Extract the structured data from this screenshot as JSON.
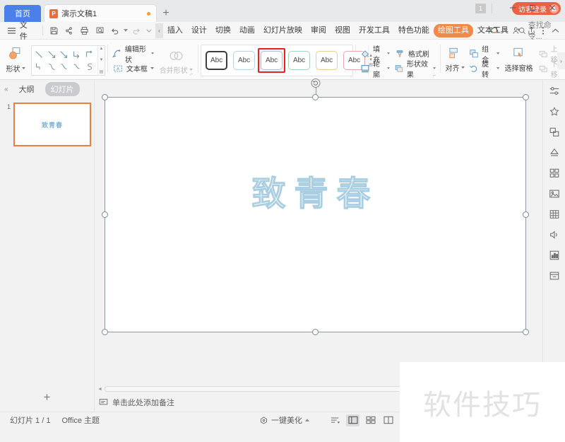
{
  "window": {
    "home_tab": "首页",
    "document_tab": "演示文稿1",
    "new_tab": "+",
    "minimize": "—",
    "maximize": "□",
    "close": "✕",
    "badge_count": "1",
    "login_label": "访客登录"
  },
  "menubar": {
    "file_label": "文件",
    "tabs": [
      {
        "label": "插入",
        "state": "active-underline"
      },
      {
        "label": "设计",
        "state": "normal"
      },
      {
        "label": "切换",
        "state": "normal"
      },
      {
        "label": "动画",
        "state": "normal"
      },
      {
        "label": "幻灯片放映",
        "state": "normal"
      },
      {
        "label": "审阅",
        "state": "normal"
      },
      {
        "label": "视图",
        "state": "normal"
      },
      {
        "label": "开发工具",
        "state": "normal"
      },
      {
        "label": "特色功能",
        "state": "normal"
      },
      {
        "label": "绘图工具",
        "state": "active-orange"
      },
      {
        "label": "文本工具",
        "state": "normal"
      }
    ],
    "search_placeholder": "查找命令..."
  },
  "ribbon": {
    "shapes_label": "形状",
    "edit_shape_label": "编辑形状",
    "textbox_label": "文本框",
    "merge_shapes_label": "合并形状",
    "style_swatches": [
      {
        "label": "Abc",
        "border": "#3d3d3d",
        "selected": false
      },
      {
        "label": "Abc",
        "border": "#b9d3e8",
        "selected": false
      },
      {
        "label": "Abc",
        "border": "#aec4d2",
        "selected": true
      },
      {
        "label": "Abc",
        "border": "#a9d5bd",
        "selected": false
      },
      {
        "label": "Abc",
        "border": "#e8cf92",
        "selected": false
      },
      {
        "label": "Abc",
        "border": "#e8a8a8",
        "selected": false
      }
    ],
    "fill_label": "填充",
    "outline_label": "轮廓",
    "format_painter_label": "格式刷",
    "shape_effects_label": "形状效果",
    "align_label": "对齐",
    "group_label": "组合",
    "rotate_label": "旋转",
    "selection_pane_label": "选择窗格",
    "move_up_label": "上移",
    "move_down_label": "下移"
  },
  "leftpanel": {
    "outline_tab": "大纲",
    "slides_tab": "幻灯片",
    "slide_number": "1",
    "thumb_text": "致青春",
    "add_slide": "+"
  },
  "slide": {
    "title_text": "致青春"
  },
  "notes": {
    "placeholder": "单击此处添加备注"
  },
  "statusbar": {
    "slide_count": "幻灯片 1 / 1",
    "theme": "Office 主题",
    "beautify_label": "一键美化"
  },
  "watermark": {
    "text": "软件技巧"
  },
  "colors": {
    "accent_orange": "#f08a4b",
    "selection_red": "#e8231f",
    "login_red": "#ec6145",
    "home_blue": "#4b80e8",
    "slide_text": "#a9cee2"
  }
}
